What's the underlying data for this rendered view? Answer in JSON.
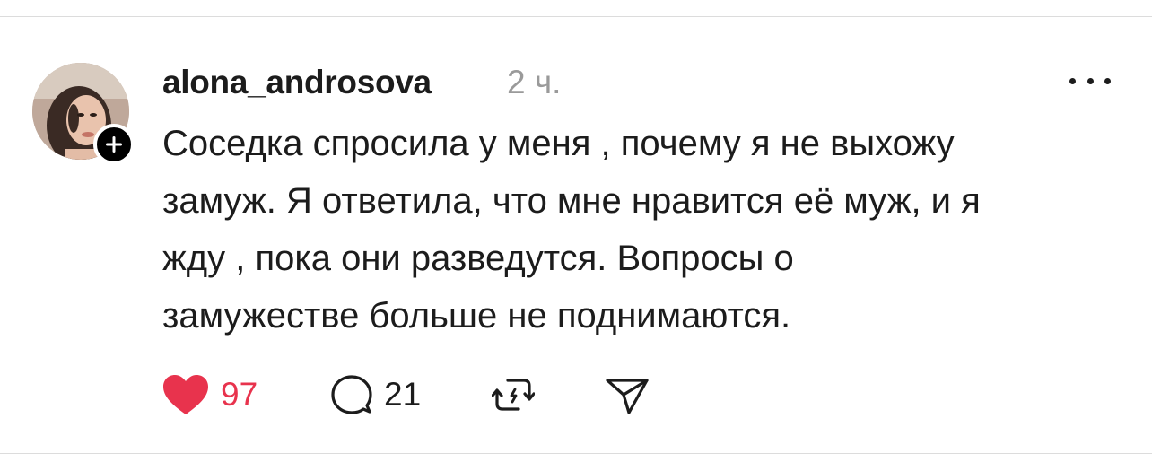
{
  "post": {
    "username": "alona_androsova",
    "timestamp": "2 ч.",
    "text_lines": [
      "Соседка спросила у меня , почему я не выхожу",
      "замуж. Я ответила, что мне нравится её муж, и я",
      "жду , пока они разведутся. Вопросы о",
      "замужестве больше не поднимаются."
    ],
    "likes": "97",
    "comments": "21"
  },
  "colors": {
    "like_active": "#e8334d",
    "text": "#1c1c1c",
    "muted": "#9a9a9a"
  },
  "icons": {
    "like": "heart-icon",
    "comment": "comment-bubble-icon",
    "repost": "repost-icon",
    "share": "send-icon",
    "more": "more-dots-icon",
    "follow": "plus-icon"
  }
}
